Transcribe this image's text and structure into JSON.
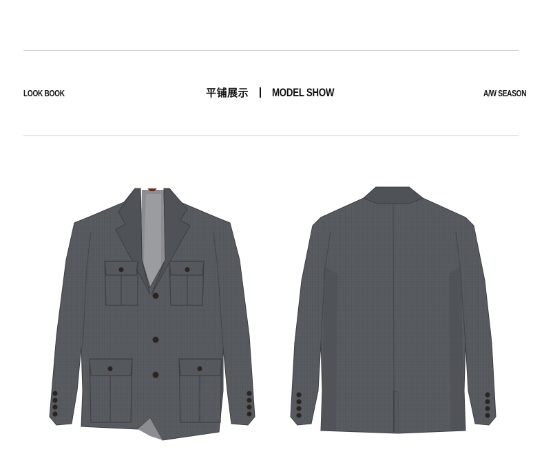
{
  "header": {
    "left_label": "LOOK BOOK",
    "title_cn": "平铺展示",
    "title_en": "MODEL SHOW",
    "right_label": "A/W SEASON"
  },
  "colors": {
    "fabric": "#565a5e",
    "fabric_dark": "#3f4246",
    "lining": "#8b8d90",
    "rule": "#cfcfcf",
    "button": "#2b2522"
  },
  "images": {
    "front": "grey-blazer-front-view",
    "back": "grey-blazer-back-view"
  }
}
